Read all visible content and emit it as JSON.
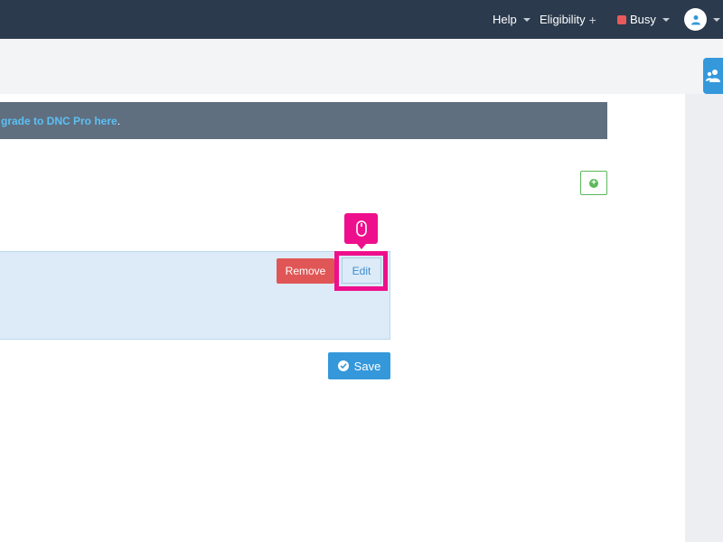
{
  "nav": {
    "help_label": "Help",
    "eligibility_label": "Eligibility",
    "eligibility_icon": "plus-icon",
    "status_label": "Busy",
    "status_color": "#e85a5a",
    "user_icon": "user-icon"
  },
  "banner": {
    "link_text": "grade to DNC Pro here",
    "trailing_text": "."
  },
  "actions": {
    "add_icon": "plus-circle-icon",
    "remove_label": "Remove",
    "edit_label": "Edit",
    "save_label": "Save",
    "save_icon": "check-circle-icon"
  },
  "overlay": {
    "pointer_icon": "mouse-icon",
    "highlight_color": "#ee0f8c"
  },
  "side_tab": {
    "icon": "users-icon"
  }
}
